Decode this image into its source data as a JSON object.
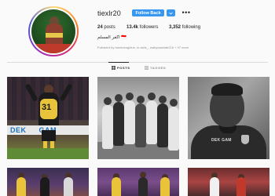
{
  "profile": {
    "username": "tiexlr20",
    "follow_label": "Follow Back",
    "more_label": "•••",
    "posts_count": "24",
    "posts_label": "posts",
    "followers_count": "13.4k",
    "followers_label": "followers",
    "following_count": "3,352",
    "following_label": "following",
    "bio": "اكفر المسلم 🇮🇩",
    "followed_by": "Followed by bandoengblue, m.alvis_, wahyuwahab316 + 97 more"
  },
  "tabs": {
    "posts_label": "POSTS",
    "tagged_label": "TAGGED"
  },
  "grid": {
    "tile1_number": "31",
    "tile1_banner": "DEK",
    "tile1_banner_suffix": "GAM",
    "tile3_logo": "DEK GAM"
  },
  "colors": {
    "accent": "#3897f0",
    "text": "#262626",
    "muted": "#8e8e8e",
    "background": "#fafafa"
  },
  "icons": {
    "grid": "grid-icon",
    "tag": "tag-icon",
    "chevron": "chevron-down-icon",
    "more": "more-icon"
  }
}
